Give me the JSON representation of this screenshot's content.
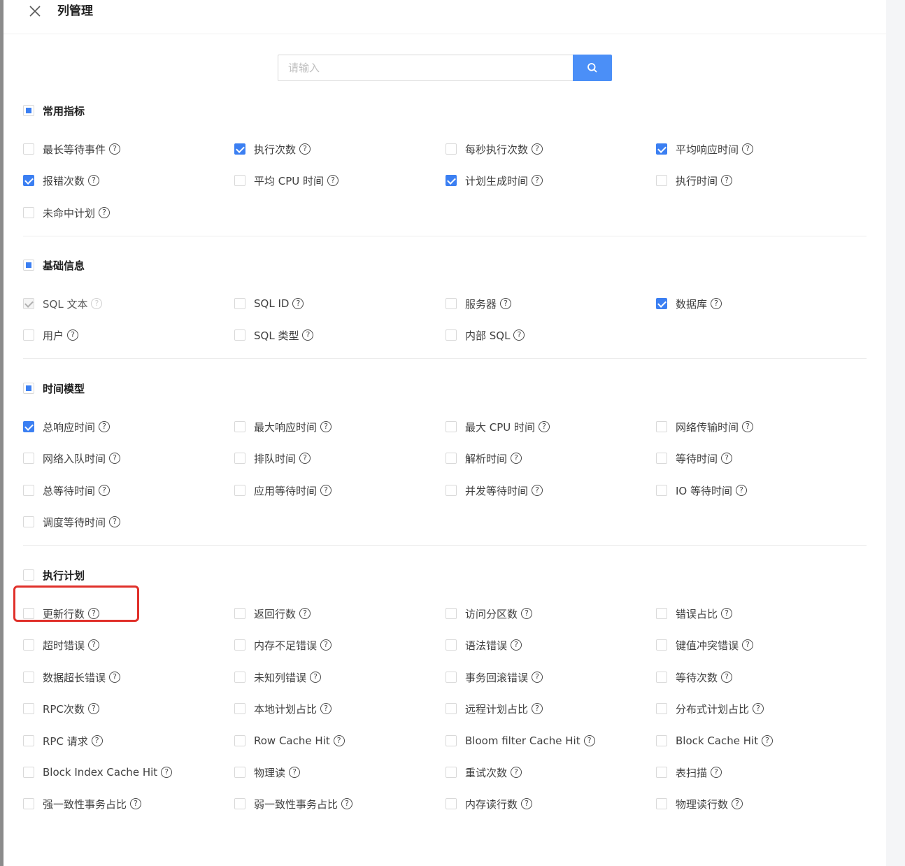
{
  "drawer": {
    "title": "列管理",
    "close_icon": "close-icon",
    "search": {
      "placeholder": "请输入",
      "value": "",
      "button_icon": "search-icon"
    }
  },
  "colors": {
    "accent": "#3b7ff2",
    "search_button": "#4b8ff7",
    "highlight": "#e0302a"
  },
  "sections": [
    {
      "title": "常用指标",
      "state": "indeterminate",
      "items": [
        {
          "label": "最长等待事件",
          "checked": false
        },
        {
          "label": "执行次数",
          "checked": true
        },
        {
          "label": "每秒执行次数",
          "checked": false
        },
        {
          "label": "平均响应时间",
          "checked": true
        },
        {
          "label": "报错次数",
          "checked": true
        },
        {
          "label": "平均 CPU 时间",
          "checked": false
        },
        {
          "label": "计划生成时间",
          "checked": true
        },
        {
          "label": "执行时间",
          "checked": false
        },
        {
          "label": "未命中计划",
          "checked": false
        }
      ]
    },
    {
      "title": "基础信息",
      "state": "indeterminate",
      "items": [
        {
          "label": "SQL 文本",
          "checked": true,
          "disabled": true
        },
        {
          "label": "SQL ID",
          "checked": false
        },
        {
          "label": "服务器",
          "checked": false
        },
        {
          "label": "数据库",
          "checked": true
        },
        {
          "label": "用户",
          "checked": false
        },
        {
          "label": "SQL 类型",
          "checked": false
        },
        {
          "label": "内部 SQL",
          "checked": false
        }
      ]
    },
    {
      "title": "时间模型",
      "state": "indeterminate",
      "items": [
        {
          "label": "总响应时间",
          "checked": true
        },
        {
          "label": "最大响应时间",
          "checked": false
        },
        {
          "label": "最大 CPU 时间",
          "checked": false
        },
        {
          "label": "网络传输时间",
          "checked": false
        },
        {
          "label": "网络入队时间",
          "checked": false
        },
        {
          "label": "排队时间",
          "checked": false
        },
        {
          "label": "解析时间",
          "checked": false
        },
        {
          "label": "等待时间",
          "checked": false
        },
        {
          "label": "总等待时间",
          "checked": false
        },
        {
          "label": "应用等待时间",
          "checked": false
        },
        {
          "label": "并发等待时间",
          "checked": false
        },
        {
          "label": "IO 等待时间",
          "checked": false
        },
        {
          "label": "调度等待时间",
          "checked": false
        }
      ]
    },
    {
      "title": "执行计划",
      "state": "unchecked",
      "items": [
        {
          "label": "更新行数",
          "checked": false
        },
        {
          "label": "返回行数",
          "checked": false
        },
        {
          "label": "访问分区数",
          "checked": false
        },
        {
          "label": "错误占比",
          "checked": false
        },
        {
          "label": "超时错误",
          "checked": false
        },
        {
          "label": "内存不足错误",
          "checked": false
        },
        {
          "label": "语法错误",
          "checked": false
        },
        {
          "label": "键值冲突错误",
          "checked": false
        },
        {
          "label": "数据超长错误",
          "checked": false
        },
        {
          "label": "未知列错误",
          "checked": false
        },
        {
          "label": "事务回滚错误",
          "checked": false
        },
        {
          "label": "等待次数",
          "checked": false
        },
        {
          "label": "RPC次数",
          "checked": false
        },
        {
          "label": "本地计划占比",
          "checked": false
        },
        {
          "label": "远程计划占比",
          "checked": false
        },
        {
          "label": "分布式计划占比",
          "checked": false
        },
        {
          "label": "RPC 请求",
          "checked": false
        },
        {
          "label": "Row Cache Hit",
          "checked": false
        },
        {
          "label": "Bloom filter Cache Hit",
          "checked": false
        },
        {
          "label": "Block Cache Hit",
          "checked": false
        },
        {
          "label": "Block Index Cache Hit",
          "checked": false
        },
        {
          "label": "物理读",
          "checked": false
        },
        {
          "label": "重试次数",
          "checked": false
        },
        {
          "label": "表扫描",
          "checked": false
        },
        {
          "label": "强一致性事务占比",
          "checked": false
        },
        {
          "label": "弱一致性事务占比",
          "checked": false
        },
        {
          "label": "内存读行数",
          "checked": false
        },
        {
          "label": "物理读行数",
          "checked": false
        }
      ]
    }
  ],
  "help_icon": "question-circle-icon"
}
